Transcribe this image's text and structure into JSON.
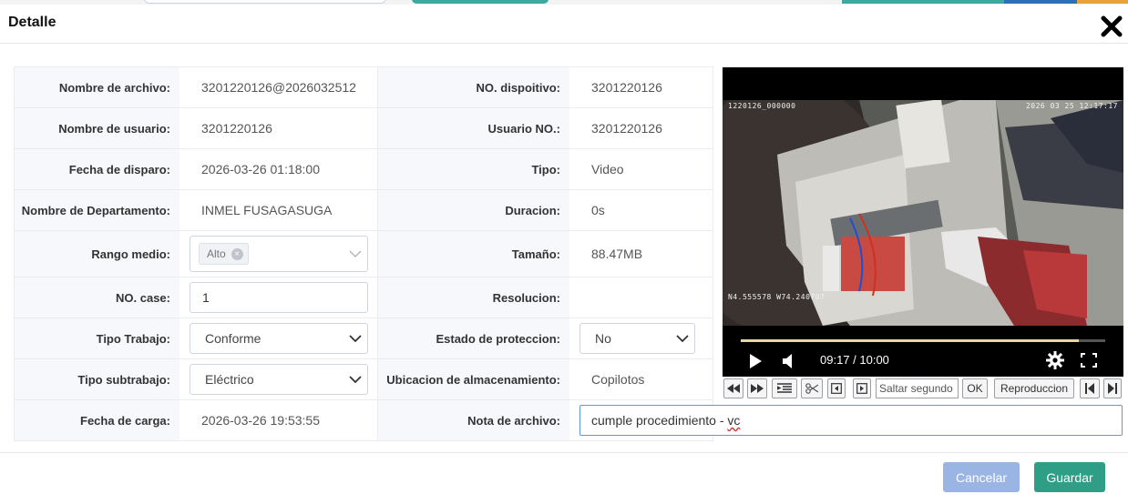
{
  "dialog": {
    "title": "Detalle"
  },
  "fields": {
    "nombre_archivo": {
      "label": "Nombre de archivo:",
      "value": "3201220126@2026032512"
    },
    "no_dispositivo": {
      "label": "NO. dispoitivo:",
      "value": "3201220126"
    },
    "nombre_usuario": {
      "label": "Nombre de usuario:",
      "value": "3201220126"
    },
    "usuario_no": {
      "label": "Usuario NO.:",
      "value": "3201220126"
    },
    "fecha_disparo": {
      "label": "Fecha de disparo:",
      "value": "2026-03-26 01:18:00"
    },
    "tipo": {
      "label": "Tipo:",
      "value": "Video"
    },
    "departamento": {
      "label": "Nombre de Departamento:",
      "value": "INMEL FUSAGASUGA"
    },
    "duracion": {
      "label": "Duracion:",
      "value": "0s"
    },
    "rango_medio": {
      "label": "Rango medio:",
      "tag": "Alto"
    },
    "tamano": {
      "label": "Tamaño:",
      "value": "88.47MB"
    },
    "no_case": {
      "label": "NO. case:",
      "value": "1"
    },
    "resolucion": {
      "label": "Resolucion:",
      "value": ""
    },
    "tipo_trabajo": {
      "label": "Tipo Trabajo:",
      "value": "Conforme"
    },
    "estado_proteccion": {
      "label": "Estado de proteccion:",
      "value": "No"
    },
    "tipo_subtrabajo": {
      "label": "Tipo subtrabajo:",
      "value": "Eléctrico"
    },
    "ubicacion": {
      "label": "Ubicacion de almacenamiento:",
      "value": "Copilotos"
    },
    "fecha_carga": {
      "label": "Fecha de carga:",
      "value": "2026-03-26 19:53:55"
    },
    "nota_archivo": {
      "label": "Nota de archivo:",
      "value_main": "cumple procedimiento - ",
      "value_flagged": "vc"
    }
  },
  "video": {
    "osd_top_left": "1220126_000000",
    "osd_top_right": "2026 03 25 12:17:17",
    "osd_coords": "N4.555578  W74.240707",
    "time_display": "09:17 / 10:00",
    "progress_fraction": 0.928,
    "toolbar": {
      "seek_placeholder": "Saltar segundo",
      "ok_label": "OK",
      "playback_label": "Reproduccion"
    }
  },
  "footer": {
    "cancel_label": "Cancelar",
    "save_label": "Guardar"
  },
  "colors": {
    "cancel_button": "#9ab5e4",
    "save_button": "#2f9e86",
    "label_background": "#f6f8fb",
    "focused_border": "#5a9bd8"
  },
  "icons": [
    "close-icon",
    "chevron-down-icon",
    "tag-remove-icon",
    "play-icon",
    "volume-icon",
    "settings-icon",
    "fullscreen-icon",
    "rewind-icon",
    "fast-forward-icon",
    "list-icon",
    "scissors-icon",
    "frame-back-icon",
    "frame-forward-icon",
    "skip-start-icon",
    "skip-end-icon"
  ]
}
